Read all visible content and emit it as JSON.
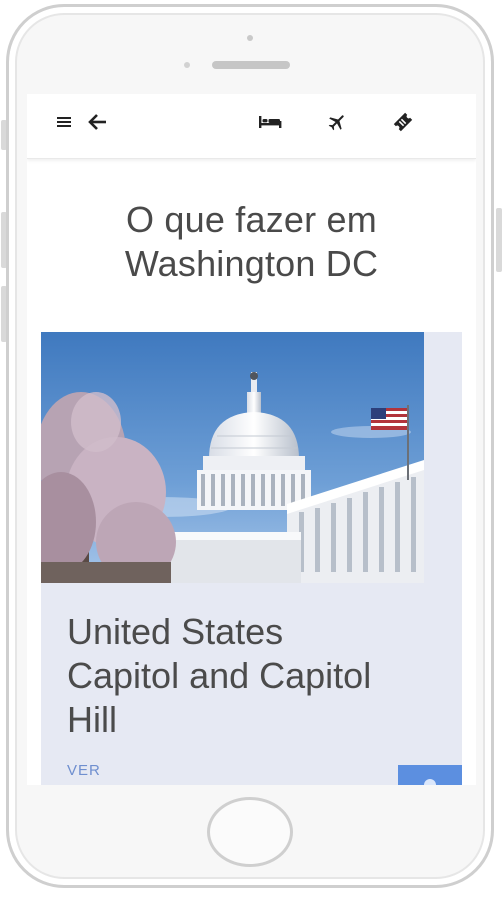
{
  "appbar": {
    "icons": {
      "menu": "menu-icon",
      "back": "arrow-back-icon",
      "hotel": "hotel-bed-icon",
      "flight": "airplane-icon",
      "ticket": "ticket-icon"
    }
  },
  "page": {
    "title_line1": "O que fazer em",
    "title_line2": "Washington DC"
  },
  "card": {
    "title_line1": "United States",
    "title_line2": "Capitol and Capitol",
    "title_line3": "Hill",
    "link_label": "VER",
    "image_subject": "capitol-building-photo"
  },
  "colors": {
    "title_text": "#4a4a4a",
    "card_background": "#e6e9f3",
    "link": "#6f8fcf",
    "fab": "#5c8fe0",
    "sky": "#5c8fc7"
  }
}
